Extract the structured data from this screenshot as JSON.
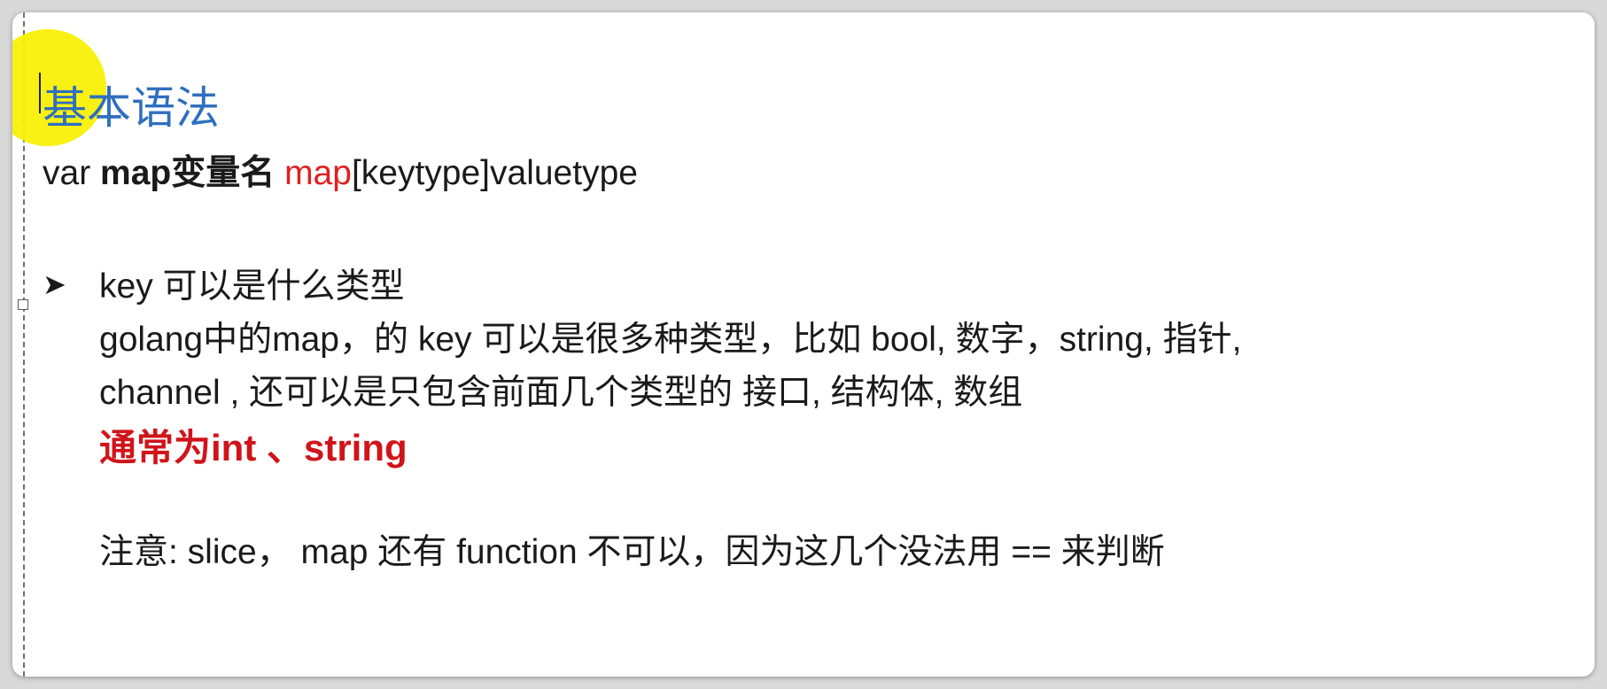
{
  "title": "基本语法",
  "syntax": {
    "part1": "var ",
    "part2": "map变量名",
    "part3": " ",
    "part4": "map",
    "part5": "[keytype]valuetype"
  },
  "bullet": {
    "arrow": "➤",
    "heading": "key 可以是什么类型"
  },
  "description": {
    "line1": "golang中的map，的 key 可以是很多种类型，比如 bool, 数字，string, 指针,",
    "line2": "channel , 还可以是只包含前面几个类型的 接口, 结构体, 数组"
  },
  "emphasis": "通常为int 、string",
  "note": "注意: slice，  map 还有 function 不可以，因为这几个没法用 == 来判断",
  "colors": {
    "title": "#2f6fbe",
    "keyword_red": "#e02020",
    "emphasis_red": "#d0141a",
    "cursor_highlight": "#f8f000"
  }
}
